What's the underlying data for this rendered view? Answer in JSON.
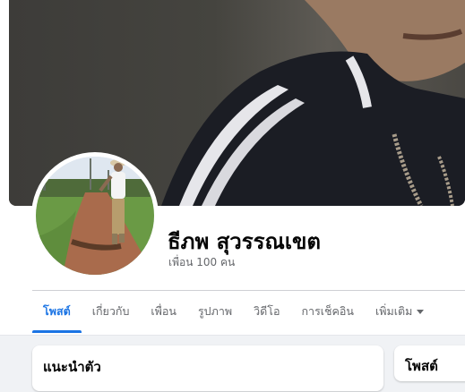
{
  "profile": {
    "name": "ธีภพ สุวรรณเขต",
    "friends_text": "เพื่อน 100 คน"
  },
  "tabs": [
    {
      "label": "โพสต์",
      "active": true
    },
    {
      "label": "เกี่ยวกับ",
      "active": false
    },
    {
      "label": "เพื่อน",
      "active": false
    },
    {
      "label": "รูปภาพ",
      "active": false
    },
    {
      "label": "วิดีโอ",
      "active": false
    },
    {
      "label": "การเช็คอิน",
      "active": false
    },
    {
      "label": "เพิ่มเติม",
      "active": false
    }
  ],
  "cards": {
    "intro_title": "แนะนำตัว",
    "posts_title": "โพสต์"
  },
  "colors": {
    "accent": "#1b74e4",
    "text_primary": "#050505",
    "text_secondary": "#65676b",
    "feed_background": "#f0f2f5"
  },
  "icons": {
    "more_tab": "caret-down-icon"
  }
}
